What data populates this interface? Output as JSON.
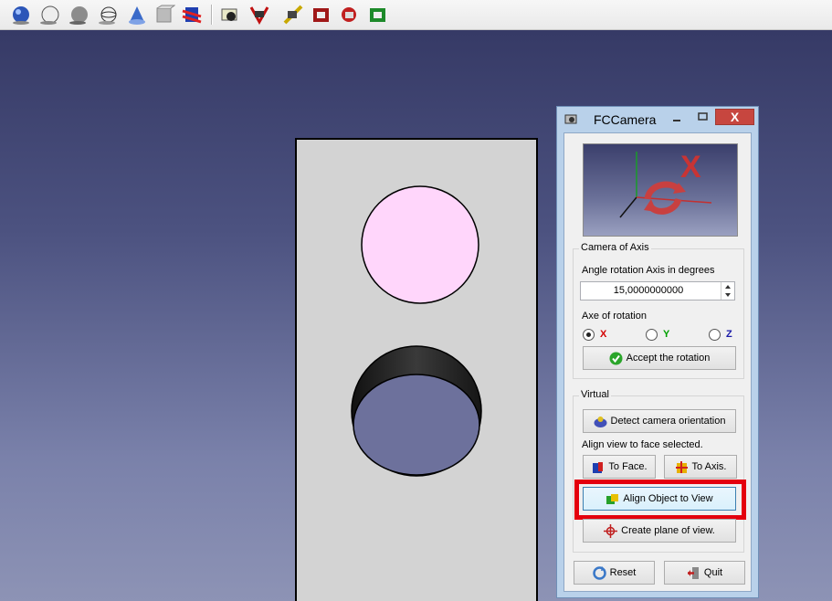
{
  "toolbar": {
    "groups": [
      [
        "view-shaded-icon",
        "view-flat-lines-icon",
        "view-no-shading-icon",
        "view-wireframe-icon",
        "view-points-icon",
        "view-hidden-line-icon",
        "view-stereo-icon"
      ],
      [
        "camera-view-icon",
        "camera-axis-icon",
        "measure-icon",
        "clipping-icon",
        "section-icon",
        "snapshot-icon"
      ]
    ]
  },
  "dialog": {
    "title": "FCCamera",
    "close_glyph": "X",
    "preview_letter": "X",
    "camera_axis": {
      "group_title": "Camera of Axis",
      "angle_label": "Angle rotation Axis in degrees",
      "angle_value": "15,0000000000",
      "axe_label": "Axe of rotation",
      "radios": [
        {
          "label": "X",
          "color": "#d40000",
          "checked": true
        },
        {
          "label": "Y",
          "color": "#00a000",
          "checked": false
        },
        {
          "label": "Z",
          "color": "#1a1aa8",
          "checked": false
        }
      ],
      "accept_label": "Accept the rotation"
    },
    "virtual": {
      "group_title": "Virtual",
      "detect_label": "Detect camera orientation",
      "align_label": "Align view to face selected.",
      "to_face_label": "To Face.",
      "to_axis_label": "To Axis.",
      "align_object_label": "Align Object to View",
      "create_plane_label": "Create plane of view."
    },
    "reset_label": "Reset",
    "quit_label": "Quit"
  },
  "colors": {
    "highlight": "#e4000d",
    "hole_face": "#ffd6fb",
    "part": "#d3d3d3"
  }
}
